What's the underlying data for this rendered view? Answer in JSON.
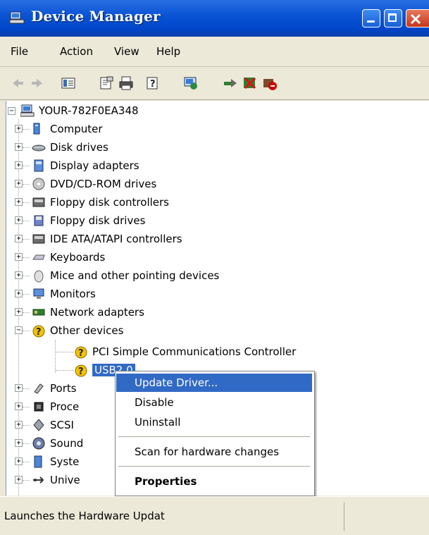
{
  "window": {
    "title": "Device Manager"
  },
  "menu": [
    "File",
    "Action",
    "View",
    "Help"
  ],
  "toolbar": [
    "back-icon",
    "forward-icon",
    "show-hide-console-tree-icon",
    "properties-icon",
    "print-icon",
    "help-icon",
    "scan-hardware-icon",
    "update-driver-icon",
    "uninstall-icon",
    "disable-icon"
  ],
  "tree": {
    "root": "YOUR-782F0EA348",
    "categories": [
      {
        "label": "Computer",
        "icon": "computer-icon"
      },
      {
        "label": "Disk drives",
        "icon": "disk-drive-icon"
      },
      {
        "label": "Display adapters",
        "icon": "display-adapter-icon"
      },
      {
        "label": "DVD/CD-ROM drives",
        "icon": "dvd-drive-icon"
      },
      {
        "label": "Floppy disk controllers",
        "icon": "floppy-controller-icon"
      },
      {
        "label": "Floppy disk drives",
        "icon": "floppy-drive-icon"
      },
      {
        "label": "IDE ATA/ATAPI controllers",
        "icon": "ide-controller-icon"
      },
      {
        "label": "Keyboards",
        "icon": "keyboard-icon"
      },
      {
        "label": "Mice and other pointing devices",
        "icon": "mouse-icon"
      },
      {
        "label": "Monitors",
        "icon": "monitor-icon"
      },
      {
        "label": "Network adapters",
        "icon": "network-adapter-icon"
      },
      {
        "label": "Other devices",
        "icon": "unknown-device-icon"
      }
    ],
    "other_devices": [
      {
        "label": "PCI Simple Communications Controller"
      },
      {
        "label": "USB2.0"
      }
    ],
    "after": [
      {
        "label": "Ports",
        "icon": "port-icon"
      },
      {
        "label": "Proce",
        "icon": "processor-icon"
      },
      {
        "label": "SCSI",
        "icon": "scsi-icon"
      },
      {
        "label": "Sound",
        "icon": "sound-icon"
      },
      {
        "label": "Syste",
        "icon": "system-icon"
      },
      {
        "label": "Unive",
        "icon": "usb-icon"
      }
    ]
  },
  "context_menu": {
    "items": [
      "Update Driver...",
      "Disable",
      "Uninstall",
      "Scan for hardware changes",
      "Properties"
    ]
  },
  "status": {
    "text": "Launches the Hardware Updat"
  }
}
